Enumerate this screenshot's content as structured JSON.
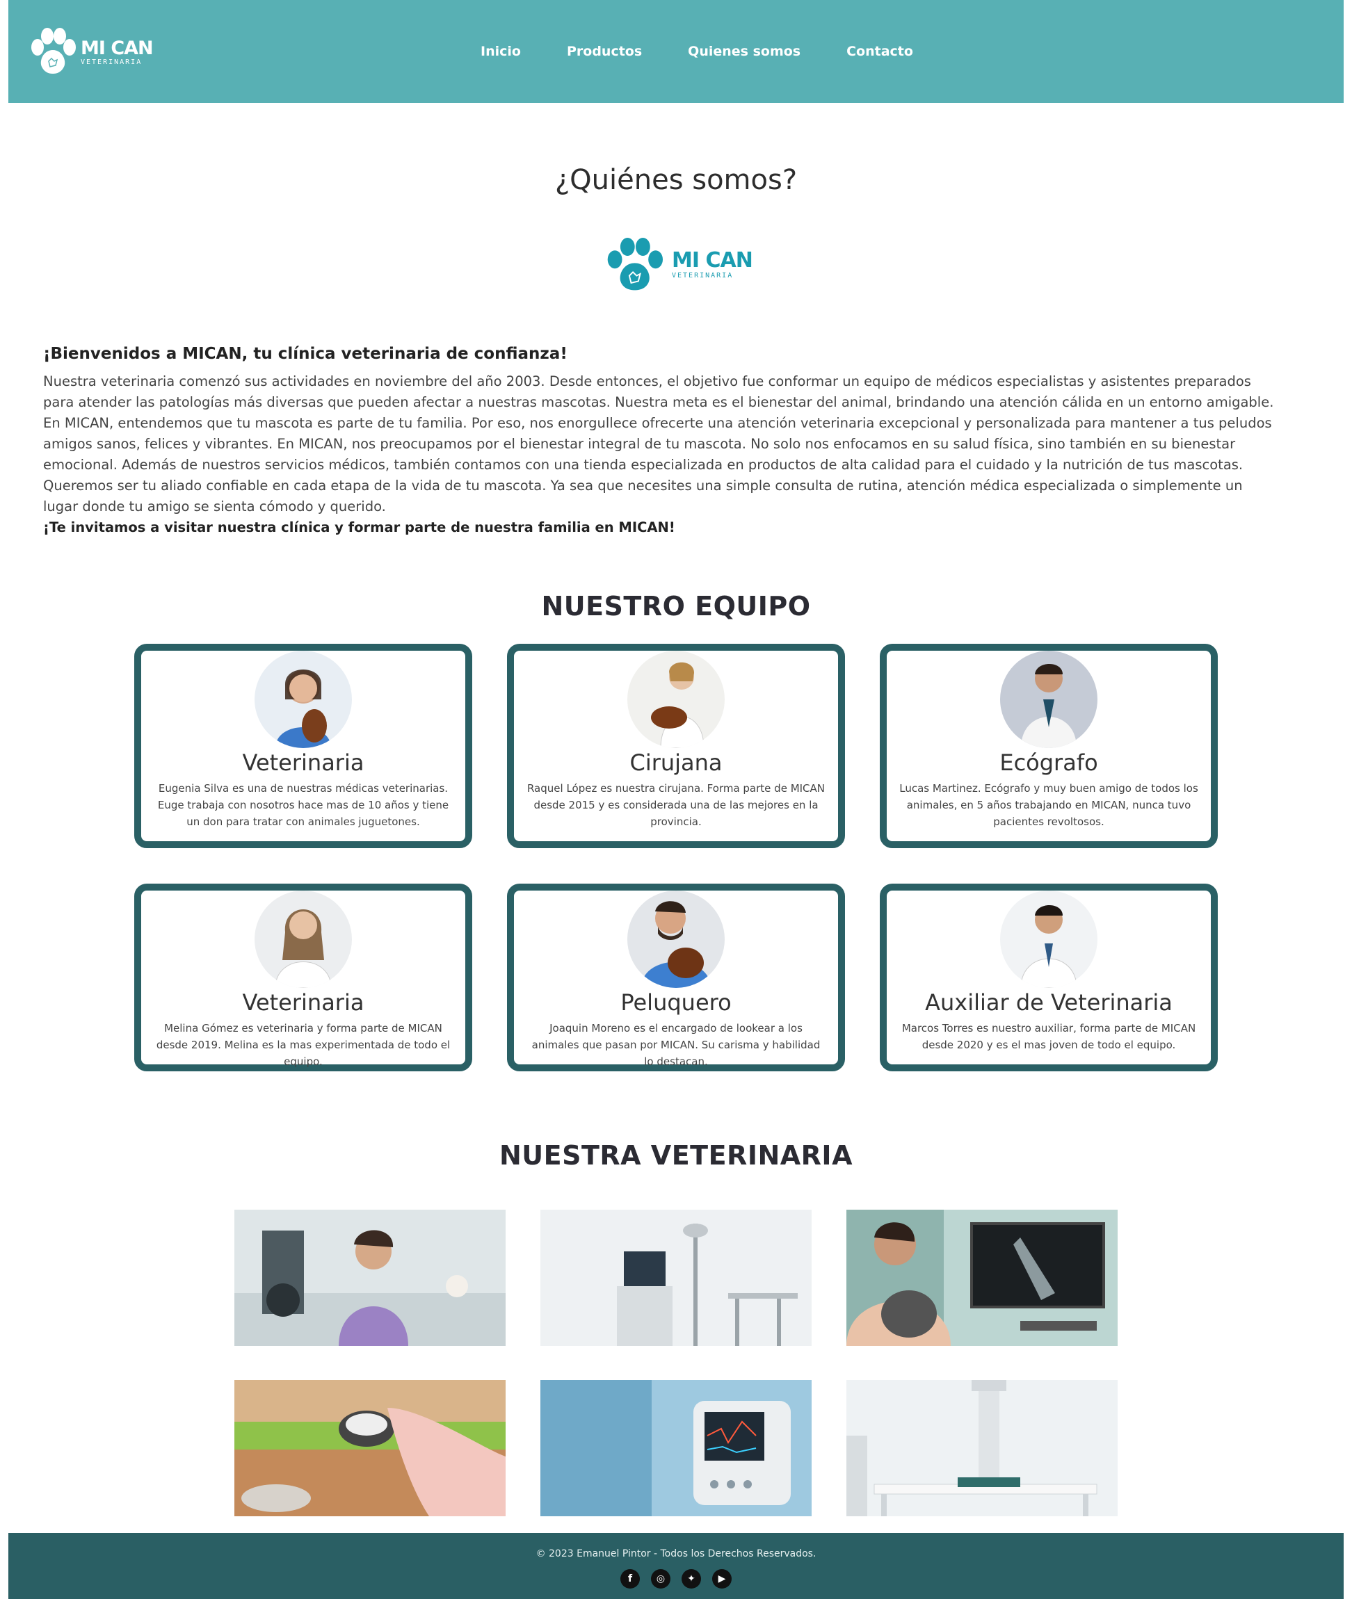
{
  "header": {
    "logo_main": "MI CAN",
    "logo_sub": "VETERINARIA",
    "nav": [
      "Inicio",
      "Productos",
      "Quienes somos",
      "Contacto"
    ]
  },
  "page": {
    "title": "¿Quiénes somos?",
    "logo_main": "MI CAN",
    "logo_sub": "VETERINARIA"
  },
  "intro": {
    "heading": "¡Bienvenidos a MICAN, tu clínica veterinaria de confianza!",
    "body": "Nuestra veterinaria comenzó sus actividades en noviembre del año 2003. Desde entonces, el objetivo fue conformar un equipo de médicos especialistas y asistentes preparados para atender las patologías más diversas que pueden afectar a nuestras mascotas. Nuestra meta es el bienestar del animal, brindando una atención cálida en un entorno amigable. En MICAN, entendemos que tu mascota es parte de tu familia. Por eso, nos enorgullece ofrecerte una atención veterinaria excepcional y personalizada para mantener a tus peludos amigos sanos, felices y vibrantes. En MICAN, nos preocupamos por el bienestar integral de tu mascota. No solo nos enfocamos en su salud física, sino también en su bienestar emocional. Además de nuestros servicios médicos, también contamos con una tienda especializada en productos de alta calidad para el cuidado y la nutrición de tus mascotas. Queremos ser tu aliado confiable en cada etapa de la vida de tu mascota. Ya sea que necesites una simple consulta de rutina, atención médica especializada o simplemente un lugar donde tu amigo se sienta cómodo y querido.",
    "cta": "¡Te invitamos a visitar nuestra clínica y formar parte de nuestra familia en MICAN!"
  },
  "team": {
    "title": "NUESTRO EQUIPO",
    "members": [
      {
        "role": "Veterinaria",
        "desc": "Eugenia Silva es una de nuestras médicas veterinarias. Euge trabaja con nosotros hace mas de 10 años y tiene un don para tratar con animales juguetones."
      },
      {
        "role": "Cirujana",
        "desc": "Raquel López es nuestra cirujana. Forma parte de MICAN desde 2015 y es considerada una de las mejores en la provincia."
      },
      {
        "role": "Ecógrafo",
        "desc": "Lucas Martinez. Ecógrafo y muy buen amigo de todos los animales, en 5 años trabajando en MICAN, nunca tuvo pacientes revoltosos."
      },
      {
        "role": "Veterinaria",
        "desc": "Melina Gómez es veterinaria y forma parte de MICAN desde 2019. Melina es la mas experimentada de todo el equipo."
      },
      {
        "role": "Peluquero",
        "desc": "Joaquin Moreno es el encargado de lookear a los animales que pasan por MICAN. Su carisma y habilidad lo destacan."
      },
      {
        "role": "Auxiliar de Veterinaria",
        "desc": "Marcos Torres es nuestro auxiliar, forma parte de MICAN desde 2020 y es el mas joven de todo el equipo."
      }
    ]
  },
  "gallery": {
    "title": "NUESTRA VETERINARIA"
  },
  "footer": {
    "text": "© 2023 Emanuel Pintor - Todos los Derechos Reservados.",
    "socials": [
      {
        "name": "facebook-icon",
        "glyph": "f"
      },
      {
        "name": "instagram-icon",
        "glyph": "◎"
      },
      {
        "name": "twitter-icon",
        "glyph": "✦"
      },
      {
        "name": "youtube-icon",
        "glyph": "▶"
      }
    ]
  },
  "colors": {
    "header_bg": "#58b0b4",
    "card_border": "#2a6065",
    "footer_bg": "#2a5f64",
    "logo_accent": "#1a9cb0"
  }
}
